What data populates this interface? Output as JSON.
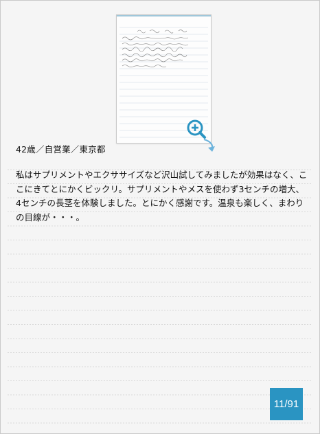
{
  "thumbnail": {
    "icon": "handwritten-letter-thumbnail"
  },
  "zoom": {
    "icon": "zoom-in-icon",
    "accent_color": "#2a94c2"
  },
  "entry": {
    "profile": "42歳／自営業／東京都",
    "testimonial": "私はサプリメントやエクササイズなど沢山試してみましたが効果はなく、ここにきてとにかくビックリ。サプリメントやメスを使わず3センチの増大、4センチの長茎を体験しました。とにかく感謝です。温泉も楽しく、まわりの目線が・・・。"
  },
  "pagination": {
    "counter": "11/91",
    "background_color": "#2a94c2"
  }
}
